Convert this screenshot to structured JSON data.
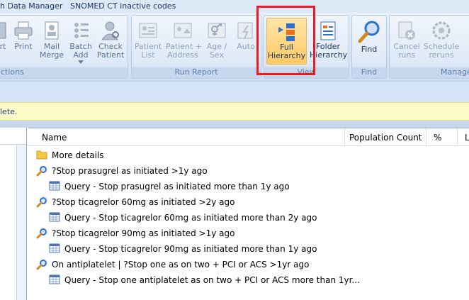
{
  "menu": {
    "item1": "h Data Manager",
    "item2": "SNOMED CT inactive codes"
  },
  "ribbon": {
    "left_group": {
      "label": "ctions",
      "buttons": [
        {
          "label": "rt"
        },
        {
          "label": "Print"
        },
        {
          "label": "Mail\nMerge"
        },
        {
          "label": "Batch\nAdd"
        },
        {
          "label": "Check\nPatient"
        }
      ]
    },
    "run_report": {
      "label": "Run Report",
      "buttons": [
        {
          "label": "Patient\nList"
        },
        {
          "label": "Patient +\nAddress"
        },
        {
          "label": "Age /\nSex"
        },
        {
          "label": "Auto"
        }
      ]
    },
    "view": {
      "label": "View",
      "buttons": [
        {
          "label": "Full\nHierarchy"
        },
        {
          "label": "Folder\nHierarchy"
        }
      ]
    },
    "find": {
      "label": "Find",
      "buttons": [
        {
          "label": "Find"
        }
      ]
    },
    "manage": {
      "label": "Manage",
      "buttons": [
        {
          "label": "Cancel\nruns"
        },
        {
          "label": "Schedule\nreruns"
        }
      ]
    }
  },
  "info_bar": "lete.",
  "table": {
    "columns": [
      "Name",
      "Population Count",
      "%",
      "L"
    ],
    "rows": [
      {
        "text": "More details",
        "icon": "folder-icon",
        "level": 0
      },
      {
        "text": "?Stop prasugrel as initiated >1y ago",
        "icon": "search-icon",
        "level": 0
      },
      {
        "text": "Query - Stop prasugrel as initiated more than 1y ago",
        "icon": "table-icon",
        "level": 1
      },
      {
        "text": "?Stop ticagrelor 60mg as initiated >2y ago",
        "icon": "search-icon",
        "level": 0
      },
      {
        "text": "Query - Stop ticagrelor 60mg as initiated more than 2y ago",
        "icon": "table-icon",
        "level": 1
      },
      {
        "text": "?Stop ticagrelor 90mg as initiated >1y ago",
        "icon": "search-icon",
        "level": 0
      },
      {
        "text": "Query - Stop ticagrelor 90mg as initiated more than 1y ago",
        "icon": "table-icon",
        "level": 1
      },
      {
        "text": "On antiplatelet | ?Stop one as on two + PCI or ACS >1yr ago",
        "icon": "search-icon",
        "level": 0
      },
      {
        "text": "Query - Stop one antiplatelet as on two + PCI or ACS more than 1yr...",
        "icon": "table-icon",
        "level": 1
      }
    ]
  },
  "colors": {
    "highlight": "#e31e24",
    "ribbon": "#dfe9f7",
    "info_bar": "#fdfbc6"
  }
}
